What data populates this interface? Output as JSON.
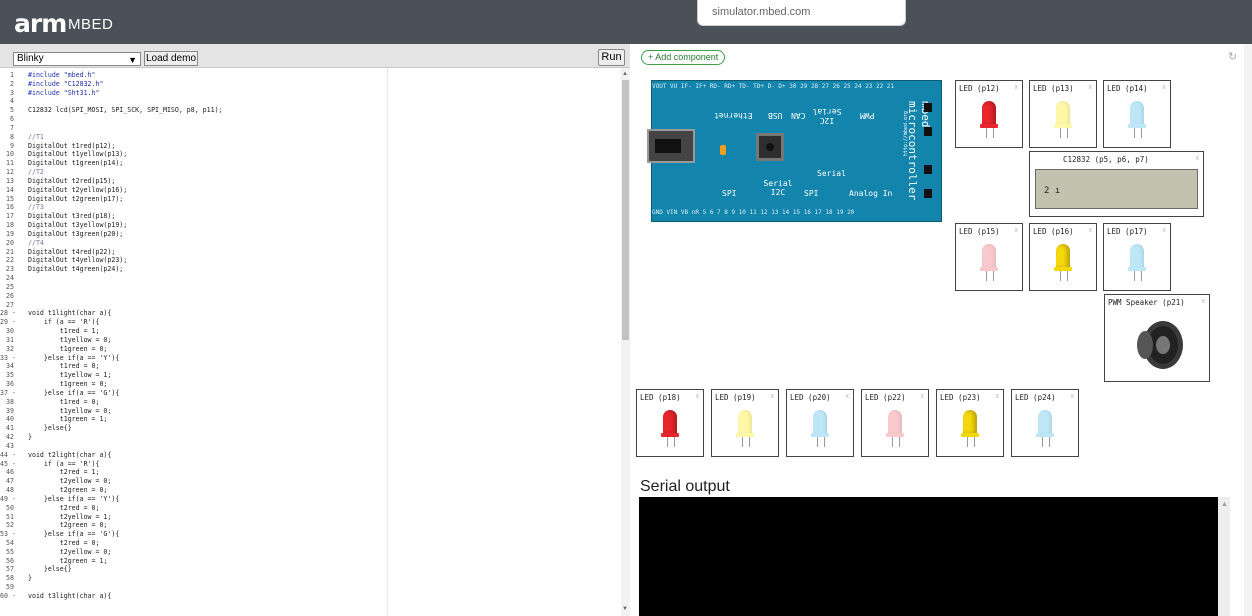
{
  "header": {
    "logo_mark": "arm",
    "logo_text": "MBED",
    "url_popup": "simulator.mbed.com"
  },
  "toolbar": {
    "demo_selected": "Blinky",
    "load_demo_label": "Load demo",
    "run_label": "Run"
  },
  "editor": {
    "lines": [
      {
        "n": "1",
        "t": "#include \"mbed.h\"",
        "k": "pp"
      },
      {
        "n": "2",
        "t": "#include \"C12832.h\"",
        "k": "pp"
      },
      {
        "n": "3",
        "t": "#include \"Sht31.h\"",
        "k": "pp"
      },
      {
        "n": "4",
        "t": "",
        "k": ""
      },
      {
        "n": "5",
        "t": "C12832 lcd(SPI_MOSI, SPI_SCK, SPI_MISO, p8, p11);",
        "k": ""
      },
      {
        "n": "6",
        "t": "",
        "k": ""
      },
      {
        "n": "7",
        "t": "",
        "k": ""
      },
      {
        "n": "8",
        "t": "//T1",
        "k": "cm"
      },
      {
        "n": "9",
        "t": "DigitalOut t1red(p12);",
        "k": ""
      },
      {
        "n": "10",
        "t": "DigitalOut t1yellow(p13);",
        "k": ""
      },
      {
        "n": "11",
        "t": "DigitalOut t1green(p14);",
        "k": ""
      },
      {
        "n": "12",
        "t": "//T2",
        "k": "cm"
      },
      {
        "n": "13",
        "t": "DigitalOut t2red(p15);",
        "k": ""
      },
      {
        "n": "14",
        "t": "DigitalOut t2yellow(p16);",
        "k": ""
      },
      {
        "n": "15",
        "t": "DigitalOut t2green(p17);",
        "k": ""
      },
      {
        "n": "16",
        "t": "//T3",
        "k": "cm"
      },
      {
        "n": "17",
        "t": "DigitalOut t3red(p18);",
        "k": ""
      },
      {
        "n": "18",
        "t": "DigitalOut t3yellow(p19);",
        "k": ""
      },
      {
        "n": "19",
        "t": "DigitalOut t3green(p20);",
        "k": ""
      },
      {
        "n": "20",
        "t": "//T4",
        "k": "cm"
      },
      {
        "n": "21",
        "t": "DigitalOut t4red(p22);",
        "k": ""
      },
      {
        "n": "22",
        "t": "DigitalOut t4yellow(p23);",
        "k": ""
      },
      {
        "n": "23",
        "t": "DigitalOut t4green(p24);",
        "k": ""
      },
      {
        "n": "24",
        "t": "",
        "k": ""
      },
      {
        "n": "25",
        "t": "",
        "k": ""
      },
      {
        "n": "26",
        "t": "",
        "k": ""
      },
      {
        "n": "27",
        "t": "",
        "k": ""
      },
      {
        "n": "28 -",
        "t": "void t1light(char a){",
        "k": "kw"
      },
      {
        "n": "29 -",
        "t": "    if (a == 'R'){",
        "k": "kw"
      },
      {
        "n": "30",
        "t": "        t1red = 1;",
        "k": ""
      },
      {
        "n": "31",
        "t": "        t1yellow = 0;",
        "k": ""
      },
      {
        "n": "32",
        "t": "        t1green = 0;",
        "k": ""
      },
      {
        "n": "33 -",
        "t": "    }else if(a == 'Y'){",
        "k": ""
      },
      {
        "n": "34",
        "t": "        t1red = 0;",
        "k": ""
      },
      {
        "n": "35",
        "t": "        t1yellow = 1;",
        "k": ""
      },
      {
        "n": "36",
        "t": "        t1green = 0;",
        "k": ""
      },
      {
        "n": "37 -",
        "t": "    }else if(a == 'G'){",
        "k": ""
      },
      {
        "n": "38",
        "t": "        t1red = 0;",
        "k": ""
      },
      {
        "n": "39",
        "t": "        t1yellow = 0;",
        "k": ""
      },
      {
        "n": "40",
        "t": "        t1green = 1;",
        "k": ""
      },
      {
        "n": "41",
        "t": "    }else{}",
        "k": ""
      },
      {
        "n": "42",
        "t": "}",
        "k": ""
      },
      {
        "n": "43",
        "t": "",
        "k": ""
      },
      {
        "n": "44 -",
        "t": "void t2light(char a){",
        "k": ""
      },
      {
        "n": "45 -",
        "t": "    if (a == 'R'){",
        "k": ""
      },
      {
        "n": "46",
        "t": "        t2red = 1;",
        "k": ""
      },
      {
        "n": "47",
        "t": "        t2yellow = 0;",
        "k": ""
      },
      {
        "n": "48",
        "t": "        t2green = 0;",
        "k": ""
      },
      {
        "n": "49 -",
        "t": "    }else if(a == 'Y'){",
        "k": ""
      },
      {
        "n": "50",
        "t": "        t2red = 0;",
        "k": ""
      },
      {
        "n": "51",
        "t": "        t2yellow = 1;",
        "k": ""
      },
      {
        "n": "52",
        "t": "        t2green = 0;",
        "k": ""
      },
      {
        "n": "53 -",
        "t": "    }else if(a == 'G'){",
        "k": ""
      },
      {
        "n": "54",
        "t": "        t2red = 0;",
        "k": ""
      },
      {
        "n": "55",
        "t": "        t2yellow = 0;",
        "k": ""
      },
      {
        "n": "56",
        "t": "        t2green = 1;",
        "k": ""
      },
      {
        "n": "57",
        "t": "    }else{}",
        "k": ""
      },
      {
        "n": "58",
        "t": "}",
        "k": ""
      },
      {
        "n": "59",
        "t": "",
        "k": ""
      },
      {
        "n": "60 -",
        "t": "void t3light(char a){",
        "k": ""
      }
    ]
  },
  "components": {
    "add_label": "+ Add component",
    "reload_icon": "reload-icon",
    "board": {
      "top_pins": "VOUT VU IF- IF+ RD- RD+ TD- TD+ D- D+ 30 29 28 27 26 25 24 23 22 21",
      "bottom_pins": "GND VIN VB nR 5 6 7 8 9 10 11 12 13 14 15 16 17 18 19 20",
      "ethernet": "Ethernet",
      "usb": "USB",
      "can": "CAN",
      "i2c_serial": "I2C Serial",
      "pwm": "PWM",
      "serial": "Serial",
      "spi": "SPI",
      "serial_i2c": "Serial I2C",
      "spi2": "SPI",
      "analog_in": "Analog In",
      "brand": "mbed microcontroller",
      "url": "http://mbed.org"
    },
    "leds_top": [
      {
        "label": "LED (p12)",
        "color": "#e8262b",
        "on": true
      },
      {
        "label": "LED (p13)",
        "color": "#fdf7a7",
        "on": false
      },
      {
        "label": "LED (p14)",
        "color": "#bde7f7",
        "on": false
      }
    ],
    "lcd": {
      "label": "C12832 (p5, p6, p7)",
      "text": "2 ı"
    },
    "leds_mid": [
      {
        "label": "LED (p15)",
        "color": "#f7c9cc",
        "on": false
      },
      {
        "label": "LED (p16)",
        "color": "#f5d80b",
        "on": true
      },
      {
        "label": "LED (p17)",
        "color": "#bde7f7",
        "on": false
      }
    ],
    "speaker": {
      "label": "PWM Speaker (p21)",
      "icon": "speaker-icon"
    },
    "leds_bottom": [
      {
        "label": "LED (p18)",
        "color": "#e8262b",
        "on": true
      },
      {
        "label": "LED (p19)",
        "color": "#fdf7a7",
        "on": false
      },
      {
        "label": "LED (p20)",
        "color": "#bde7f7",
        "on": false
      },
      {
        "label": "LED (p22)",
        "color": "#f7c9cc",
        "on": false
      },
      {
        "label": "LED (p23)",
        "color": "#f5d80b",
        "on": true
      },
      {
        "label": "LED (p24)",
        "color": "#bde7f7",
        "on": false
      }
    ],
    "close_mark": "x"
  },
  "serial": {
    "title": "Serial output"
  }
}
